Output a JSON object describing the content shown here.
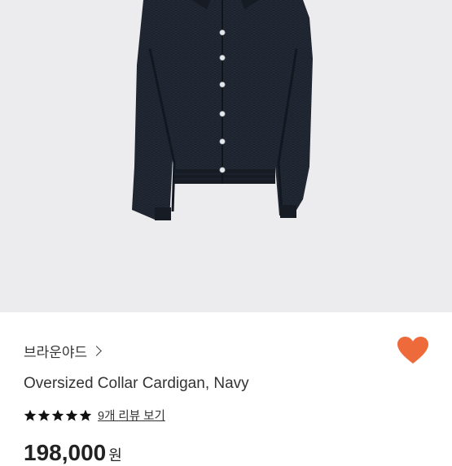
{
  "product": {
    "brand": "브라운야드",
    "name": "Oversized Collar Cardigan, Navy",
    "rating_stars": 5,
    "review_link_label": "9개 리뷰 보기",
    "price_amount": "198,000",
    "price_unit": "원"
  },
  "icons": {
    "favorite": "heart-icon",
    "brand_chevron": "chevron-right-icon",
    "star": "star-icon"
  },
  "colors": {
    "hero_background": "#ececee",
    "cardigan": "#1c222c",
    "heart": "#ee6a3b"
  }
}
